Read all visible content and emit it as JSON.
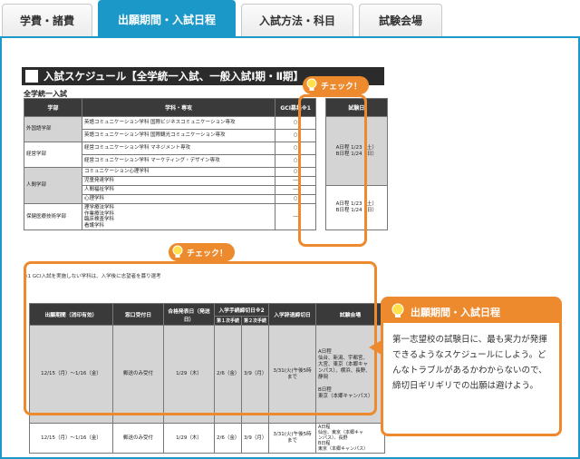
{
  "tabs": [
    {
      "label": "学費・諸費",
      "active": false
    },
    {
      "label": "出願期間・入試日程",
      "active": true
    },
    {
      "label": "入試方法・科目",
      "active": false
    },
    {
      "label": "試験会場",
      "active": false
    }
  ],
  "colors": {
    "accent": "#1b98c8",
    "highlight": "#ec8a2d"
  },
  "document": {
    "title": "入試スケジュール【全学統一入試、一般入試Ⅰ期・Ⅱ期】",
    "subtitle": "全学統一入試",
    "table1": {
      "headers": [
        "学部",
        "学科・専攻",
        "GCI募集※1",
        "試験日"
      ],
      "rows": [
        {
          "faculty": "外国語学部",
          "departments": [
            "英語コミュニケーション学科 国際ビジネスコミュニケーション専攻",
            "英語コミュニケーション学科 国際観光コミュニケーション専攻"
          ],
          "gci": [
            "○",
            "○"
          ]
        },
        {
          "faculty": "経営学部",
          "departments": [
            "経営コミュニケーション学科 マネジメント専攻",
            "経営コミュニケーション学科 マーケティング・デザイン専攻"
          ],
          "gci": [
            "○",
            "○"
          ]
        },
        {
          "faculty": "人間学部",
          "departments": [
            "コミュニケーション心理学科",
            "児童発達学科",
            "人間福祉学科",
            "心理学科"
          ],
          "gci": [
            "○",
            "―",
            "―",
            "○"
          ]
        },
        {
          "faculty": "保健医療技術学部",
          "departments": [
            "理学療法学科",
            "作業療法学科",
            "臨床検査学科",
            "看護学科"
          ],
          "gci": [
            "―"
          ]
        }
      ],
      "exam_date_1": [
        "A日程 1/23（土）",
        "B日程 1/24（日）"
      ],
      "exam_date_2": [
        "A日程 1/23（土）",
        "B日程 1/24（日）"
      ]
    },
    "note": "※1 GCI入試を実施しない学科は、入学後に志望者を募り選考",
    "table2": {
      "headers": [
        "出願期間（消印有効）",
        "窓口受付日",
        "合格発表日（発送日）",
        "入学手続締切日※2",
        "第１次手続",
        "第２次手続",
        "入学辞退締切日",
        "試験会場"
      ],
      "rows": [
        {
          "period": "12/15（月）～1/16（金）",
          "window": "郵送のみ受付",
          "announce": "1/29（木）",
          "first": "2/6（金）",
          "second": "3/9（月）",
          "withdraw": "3/31(火)午後5時まで",
          "venue": [
            "A日程",
            "仙台、新潟、宇都宮、",
            "大宮、東京（本郷キャ",
            "ンパス）、横浜、長野、",
            "静岡",
            "",
            "B日程",
            "東京（本郷キャンパス）"
          ]
        },
        {
          "period": "12/15（月）～1/16（金）",
          "window": "郵送のみ受付",
          "announce": "1/29（木）",
          "first": "2/6（金）",
          "second": "3/9（月）",
          "withdraw": "3/31(火)午後5時まで",
          "venue": [
            "A日程",
            "仙台、東京（本郷キャ",
            "ンパス）、長野",
            "B日程",
            "東京（本郷キャンパス）"
          ]
        }
      ]
    }
  },
  "check_label": "チェック！",
  "callout": {
    "title": "出願期間・入試日程",
    "body": "第一志望校の試験日に、最も実力が発揮できるようなスケジュールにしよう。どんなトラブルがあるかわからないので、締切日ギリギリでの出願は避けよう。"
  }
}
